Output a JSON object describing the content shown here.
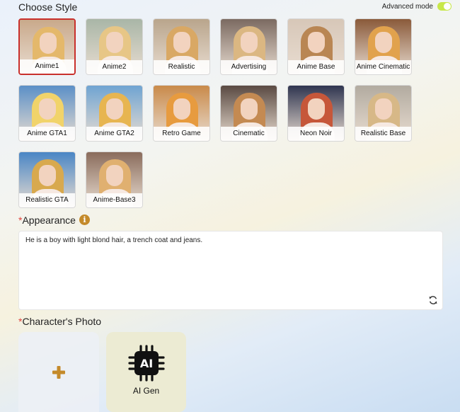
{
  "header": {
    "title": "Choose Style",
    "advanced_label": "Advanced mode",
    "advanced_on": true
  },
  "styles": [
    {
      "label": "Anime1",
      "selected": true,
      "bg": "#c9a98b",
      "hair": "#e4b86b"
    },
    {
      "label": "Anime2",
      "selected": false,
      "bg": "#a9b6a7",
      "hair": "#e7c686"
    },
    {
      "label": "Realistic",
      "selected": false,
      "bg": "#b9a58c",
      "hair": "#d9a864"
    },
    {
      "label": "Advertising",
      "selected": false,
      "bg": "#7b6a61",
      "hair": "#dbb782"
    },
    {
      "label": "Anime Base",
      "selected": false,
      "bg": "#d7c7b8",
      "hair": "#b98653"
    },
    {
      "label": "Anime Cinematic",
      "selected": false,
      "bg": "#8a5a3a",
      "hair": "#e1a24d"
    },
    {
      "label": "Anime GTA1",
      "selected": false,
      "bg": "#5b8fc7",
      "hair": "#f1d36a"
    },
    {
      "label": "Anime GTA2",
      "selected": false,
      "bg": "#6fa4d2",
      "hair": "#e7b551"
    },
    {
      "label": "Retro Game",
      "selected": false,
      "bg": "#c98a4a",
      "hair": "#e79b3f"
    },
    {
      "label": "Cinematic",
      "selected": false,
      "bg": "#5a4a42",
      "hair": "#c48a52"
    },
    {
      "label": "Neon Noir",
      "selected": false,
      "bg": "#2f3550",
      "hair": "#c6573a"
    },
    {
      "label": "Realistic Base",
      "selected": false,
      "bg": "#b2aba0",
      "hair": "#d7b887"
    },
    {
      "label": "Realistic GTA",
      "selected": false,
      "bg": "#4a86c5",
      "hair": "#d8a94e"
    },
    {
      "label": "Anime-Base3",
      "selected": false,
      "bg": "#8a6c5c",
      "hair": "#e0b070"
    }
  ],
  "appearance": {
    "required_mark": "*",
    "title": "Appearance",
    "value": "He is a boy with light blond hair, a trench coat and jeans."
  },
  "photo": {
    "required_mark": "*",
    "title": "Character's Photo",
    "ai_gen_label": "AI Gen",
    "chip_text": "AI"
  },
  "colors": {
    "accent_red": "#c9302c",
    "toggle_on": "#c8e84a",
    "info_icon": "#c48a2a",
    "plus_icon": "#c48a2a"
  }
}
